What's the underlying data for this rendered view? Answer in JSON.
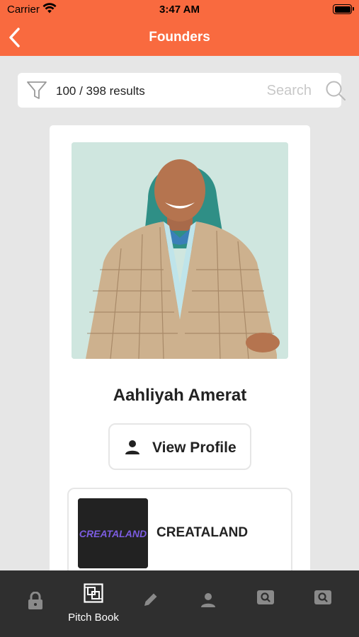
{
  "status_bar": {
    "carrier": "Carrier",
    "time": "3:47 AM"
  },
  "nav": {
    "title": "Founders"
  },
  "search": {
    "results": "100 / 398 results",
    "placeholder": "Search"
  },
  "founder": {
    "name": "Aahliyah Amerat",
    "view_profile_label": "View Profile"
  },
  "company": {
    "name": "CREATALAND",
    "logo_text": "CREATALAND"
  },
  "tab_bar": {
    "active_label": "Pitch Book",
    "items": [
      {
        "icon": "lock-icon"
      },
      {
        "icon": "pitch-book-icon",
        "label": "Pitch Book"
      },
      {
        "icon": "pencil-icon"
      },
      {
        "icon": "person-icon"
      },
      {
        "icon": "search-box-icon"
      },
      {
        "icon": "search-box-icon"
      }
    ]
  },
  "colors": {
    "accent": "#f96a3f",
    "tab_bar": "#2f2f2f",
    "background": "#e6e6e6"
  }
}
